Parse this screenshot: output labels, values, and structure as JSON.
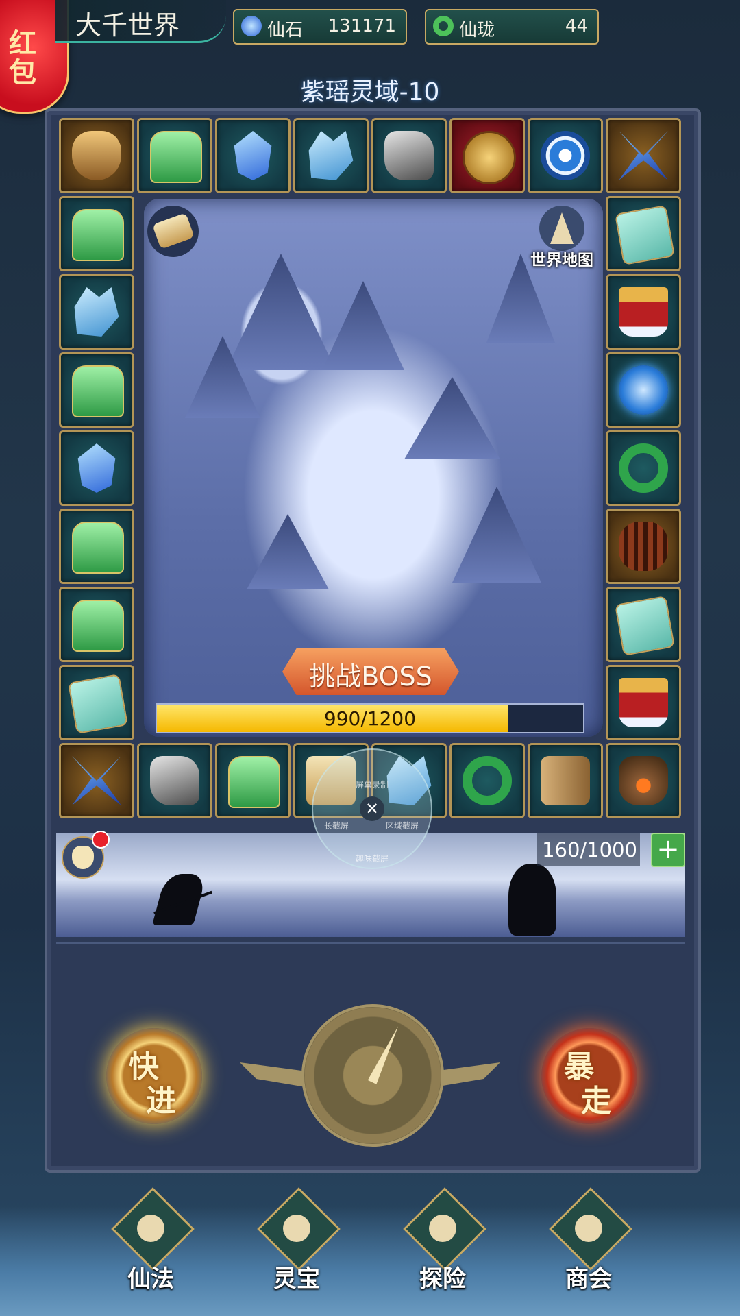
{
  "header": {
    "hongbao_label_1": "红",
    "hongbao_label_2": "包",
    "world_title": "大千世界",
    "resources": [
      {
        "label": "仙石",
        "value": "131171",
        "icon": "blue-gem-icon"
      },
      {
        "label": "仙珑",
        "value": "44",
        "icon": "jade-ring-icon"
      }
    ]
  },
  "level_title": "紫瑶灵域-10",
  "board": {
    "cells_top": [
      "tiger-mask",
      "jade-seal",
      "blue-crystal",
      "spirit-crystal",
      "iron-ore",
      "bronze-coin",
      "bagua-mirror",
      "blue-butterfly"
    ],
    "cells_left": [
      "jade-seal",
      "spirit-crystal",
      "jade-seal",
      "blue-crystal",
      "jade-seal",
      "jade-seal",
      "token-plate"
    ],
    "cells_right": [
      "token-plate",
      "red-gate",
      "water-orb",
      "jade-ring",
      "centipede",
      "token-plate",
      "red-gate"
    ],
    "cells_bottom": [
      "blue-butterfly",
      "iron-ore",
      "jade-seal",
      "mystery-scroll",
      "spirit-crystal",
      "jade-ring",
      "wood-log",
      "incense-burner"
    ]
  },
  "map": {
    "world_map_label": "世界地图",
    "boss_button": "挑战BOSS",
    "boss_progress_text": "990/1200",
    "boss_progress": 0.825
  },
  "recorder": {
    "record_label": "屏幕录制",
    "screenshot_label": "长截屏",
    "region_label": "区域截屏",
    "fun_label": "趣味截屏"
  },
  "battle": {
    "energy_text": "160/1000",
    "add_label": "+"
  },
  "controls": {
    "fast_1": "快",
    "fast_2": "进",
    "rage_1": "暴",
    "rage_2": "走"
  },
  "nav": [
    {
      "label": "仙法",
      "icon": "sword-icon"
    },
    {
      "label": "灵宝",
      "icon": "lotus-icon"
    },
    {
      "label": "探险",
      "icon": "ship-icon"
    },
    {
      "label": "商会",
      "icon": "shop-icon"
    }
  ],
  "colors": {
    "gold_border": "#b39556",
    "progress_yellow": "#f5b800",
    "boss_orange": "#d4562c",
    "hongbao_red": "#c80e1e"
  }
}
